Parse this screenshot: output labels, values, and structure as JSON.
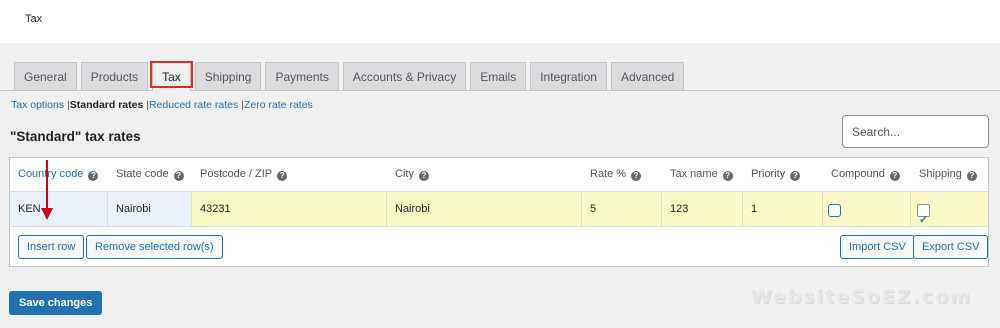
{
  "page": {
    "title": "Tax"
  },
  "tabs": [
    {
      "label": "General"
    },
    {
      "label": "Products"
    },
    {
      "label": "Tax"
    },
    {
      "label": "Shipping"
    },
    {
      "label": "Payments"
    },
    {
      "label": "Accounts & Privacy"
    },
    {
      "label": "Emails"
    },
    {
      "label": "Integration"
    },
    {
      "label": "Advanced"
    }
  ],
  "active_tab": "Tax",
  "subnav": {
    "tax_options": "Tax options",
    "separator": "|",
    "standard_rates": "Standard rates",
    "reduced_rates": "Reduced rate rates",
    "zero_rates": "Zero rate rates"
  },
  "heading": "\"Standard\" tax rates",
  "search": {
    "placeholder": "Search...",
    "value": ""
  },
  "help_glyph": "?",
  "table": {
    "columns": [
      "Country code",
      "State code",
      "Postcode / ZIP",
      "City",
      "Rate %",
      "Tax name",
      "Priority",
      "Compound",
      "Shipping"
    ],
    "row": {
      "country": "KEN",
      "state": "Nairobi",
      "postcode": "43231",
      "city": "Nairobi",
      "rate": "5",
      "tax_name": "123",
      "priority": "1",
      "compound": false,
      "shipping": true
    }
  },
  "buttons": {
    "insert_row": "Insert row",
    "remove_rows": "Remove selected row(s)",
    "import_csv": "Import CSV",
    "export_csv": "Export CSV",
    "save_changes": "Save changes"
  },
  "watermark": "WebsiteSoEZ.com",
  "colors": {
    "accent": "#2271b1",
    "highlight_box": "#e02b27",
    "arrow": "#d0021b",
    "row_bg": "#fcf9c9"
  }
}
